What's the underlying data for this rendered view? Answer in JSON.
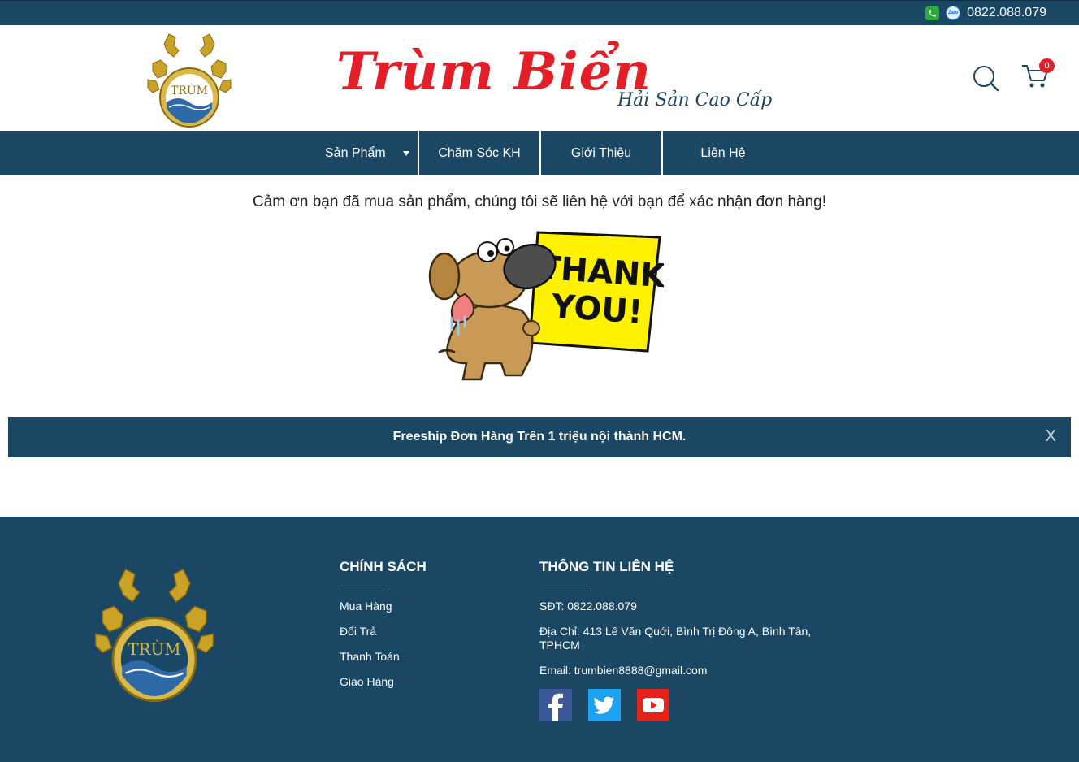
{
  "topbar": {
    "phone": "0822.088.079",
    "phone_icon": "phone-icon",
    "zalo_icon": "zalo-icon",
    "zalo_label": "Zalo"
  },
  "header": {
    "logo_text": "TRÙM",
    "brand_title": "Trùm Biển",
    "brand_subtitle": "Hải Sản Cao Cấp",
    "cart_count": "0"
  },
  "nav": {
    "items": [
      {
        "label": "Sản Phẩm"
      },
      {
        "label": "Chăm Sóc KH"
      },
      {
        "label": "Giới Thiệu"
      },
      {
        "label": "Liên Hệ"
      }
    ]
  },
  "main": {
    "thanks_message": "Cảm ơn bạn đã mua sản phẩm, chúng tôi sẽ liên hệ với bạn để xác nhận đơn hàng!",
    "sign_line1": "THANK",
    "sign_line2": "YOU!"
  },
  "banner": {
    "text": "Freeship Đơn Hàng Trên 1 triệu nội thành HCM.",
    "close": "X"
  },
  "footer": {
    "logo_text": "TRÙM",
    "policy": {
      "title": "CHÍNH SÁCH",
      "links": [
        "Mua Hàng",
        "Đổi Trả",
        "Thanh Toán",
        "Giao Hàng"
      ]
    },
    "contact": {
      "title": "THÔNG TIN LIÊN HỆ",
      "phone": "SĐT: 0822.088.079",
      "address_line1": "Địa Chỉ: 413 Lê Văn Quới, Bình Trị Đông A, Bình Tân,",
      "address_line2": "TPHCM",
      "email": "Email: trumbien8888@gmail.com"
    },
    "social": [
      {
        "name": "facebook",
        "color": "#3b5998"
      },
      {
        "name": "twitter",
        "color": "#1da1f2"
      },
      {
        "name": "youtube",
        "color": "#e62117"
      }
    ]
  },
  "colors": {
    "primary": "#1a4763",
    "brand_red": "#e41e26",
    "gold": "#c9a227"
  }
}
